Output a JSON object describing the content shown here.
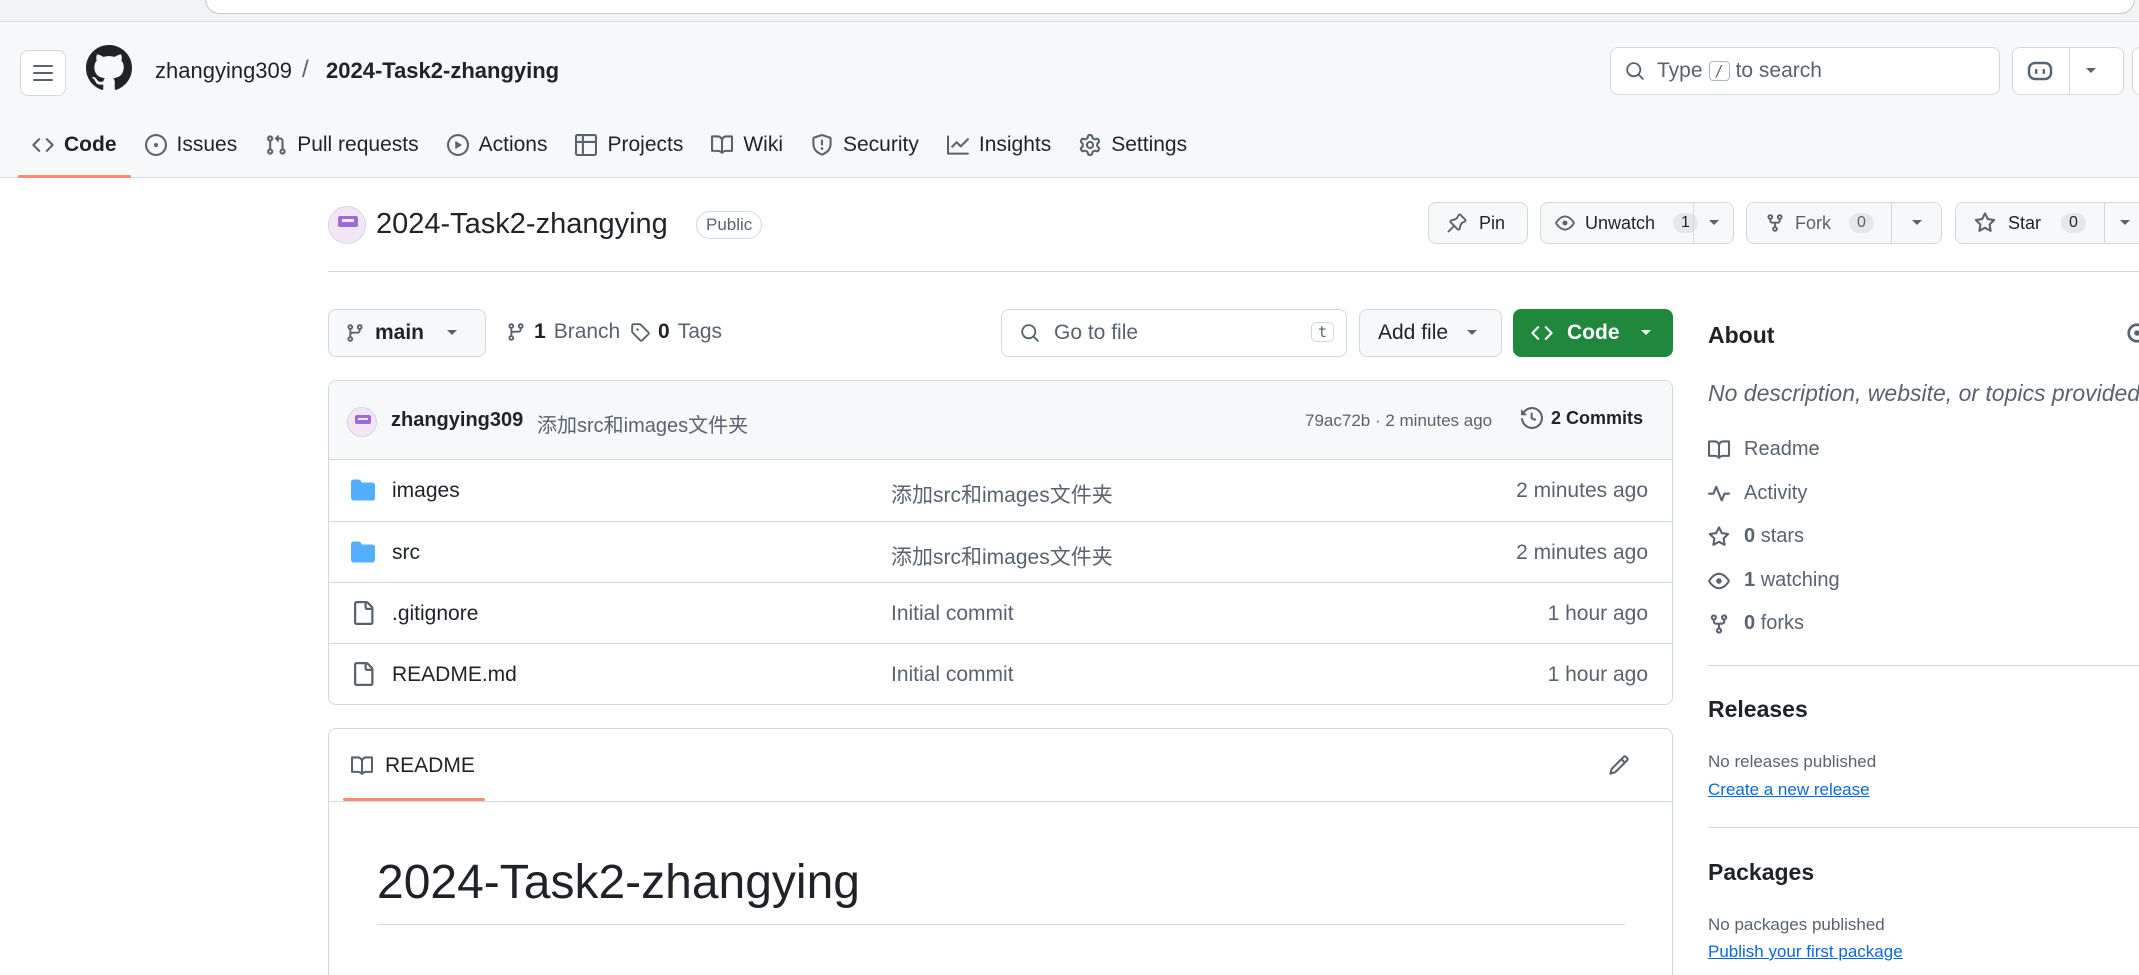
{
  "header": {
    "owner": "zhangying309",
    "separator": "/",
    "repo": "2024-Task2-zhangying",
    "search_prefix": "Type",
    "search_key": "/",
    "search_suffix": "to search"
  },
  "tabs": [
    {
      "label": "Code",
      "icon": "code-icon",
      "active": true
    },
    {
      "label": "Issues",
      "icon": "issue-opened-icon"
    },
    {
      "label": "Pull requests",
      "icon": "git-pull-request-icon"
    },
    {
      "label": "Actions",
      "icon": "play-icon"
    },
    {
      "label": "Projects",
      "icon": "table-icon"
    },
    {
      "label": "Wiki",
      "icon": "book-icon"
    },
    {
      "label": "Security",
      "icon": "shield-icon"
    },
    {
      "label": "Insights",
      "icon": "graph-icon"
    },
    {
      "label": "Settings",
      "icon": "gear-icon"
    }
  ],
  "repo": {
    "name": "2024-Task2-zhangying",
    "visibility": "Public"
  },
  "actions": {
    "pin": "Pin",
    "unwatch": "Unwatch",
    "watch_count": "1",
    "fork": "Fork",
    "fork_count": "0",
    "star": "Star",
    "star_count": "0"
  },
  "file_nav": {
    "branch": "main",
    "branch_count": "1",
    "branch_label": "Branch",
    "tag_count": "0",
    "tag_label": "Tags",
    "goto_placeholder": "Go to file",
    "goto_key": "t",
    "add_file": "Add file",
    "code": "Code"
  },
  "commit": {
    "author": "zhangying309",
    "message": "添加src和images文件夹",
    "meta": "79ac72b · 2 minutes ago",
    "commits": "2 Commits"
  },
  "files": [
    {
      "name": "images",
      "type": "folder",
      "message": "添加src和images文件夹",
      "time": "2 minutes ago"
    },
    {
      "name": "src",
      "type": "folder",
      "message": "添加src和images文件夹",
      "time": "2 minutes ago"
    },
    {
      "name": ".gitignore",
      "type": "file",
      "message": "Initial commit",
      "time": "1 hour ago"
    },
    {
      "name": "README.md",
      "type": "file",
      "message": "Initial commit",
      "time": "1 hour ago"
    }
  ],
  "readme": {
    "tab": "README",
    "title": "2024-Task2-zhangying"
  },
  "about": {
    "title": "About",
    "description": "No description, website, or topics provided.",
    "readme": "Readme",
    "activity": "Activity",
    "stars_count": "0",
    "stars_label": "stars",
    "watching_count": "1",
    "watching_label": "watching",
    "forks_count": "0",
    "forks_label": "forks"
  },
  "releases": {
    "title": "Releases",
    "none": "No releases published",
    "link": "Create a new release"
  },
  "packages": {
    "title": "Packages",
    "none": "No packages published",
    "link": "Publish your first package"
  },
  "colors": {
    "accent_green": "#1f883d",
    "tab_underline": "#fd8c73",
    "link_blue": "#0969da",
    "folder_blue": "#54aeff"
  }
}
